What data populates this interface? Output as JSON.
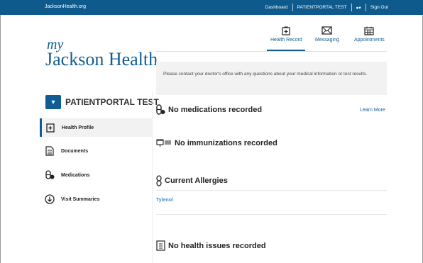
{
  "topbar": {
    "site": "JacksonHealth.org",
    "nav": [
      "Dashboard",
      "PATIENTPORTAL TEST",
      "●▾",
      "Sign Out"
    ]
  },
  "logo": {
    "my": "my",
    "main": "Jackson Health"
  },
  "user": {
    "name": "PATIENTPORTAL TEST",
    "toggle": "▾"
  },
  "sidebar": {
    "items": [
      {
        "label": "Health Profile",
        "icon": "health-profile-icon"
      },
      {
        "label": "Documents",
        "icon": "document-icon"
      },
      {
        "label": "Medications",
        "icon": "pill-icon"
      },
      {
        "label": "Visit Summaries",
        "icon": "download-circle-icon"
      }
    ]
  },
  "tabs": [
    {
      "label": "Health Record",
      "icon": "health-record-icon"
    },
    {
      "label": "Messaging",
      "icon": "envelope-icon"
    },
    {
      "label": "Appointments",
      "icon": "calendar-icon"
    }
  ],
  "notice": "Please contact your doctor's office with any questions about your medical information or test results.",
  "sections": {
    "medications": "No medications recorded",
    "learn_more": "Learn More",
    "immunizations": "No immunizations recorded",
    "allergies": "Current Allergies",
    "allergy_item": "Tylenol",
    "health_issues": "No health issues recorded"
  },
  "colors": {
    "brand": "#0f5d92",
    "topbar": "#0e5a8c",
    "link": "#4a90c8",
    "panel": "#f2f2f2"
  }
}
